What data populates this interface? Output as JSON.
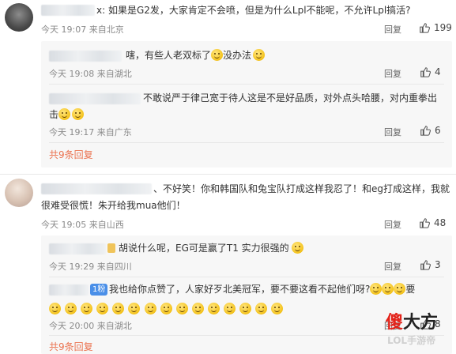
{
  "comments": [
    {
      "text_suffix": "x: 如果是G2发，大家肯定不会喷，但是为什么Lpl不能呢，不允许Lpl搞活?",
      "meta": "今天 19:07 来自北京",
      "reply": "回复",
      "likes": "199"
    },
    {
      "text_suffix": "、不好笑！你和韩国队和兔宝队打成这样我忍了！和eg打成这样，我就",
      "text_line2": "很难受很慌！朱开给我mua他们！",
      "meta": "今天 19:05 来自山西",
      "reply": "回复",
      "likes": "48"
    }
  ],
  "replies_a": [
    {
      "text_suffix": "嗐，有些人老双标了",
      "text_tail": "没办法",
      "meta": "今天 19:08 来自湖北",
      "reply": "回复",
      "likes": "4"
    },
    {
      "text_suffix": "不敢说严于律己宽于待人这是不是好品质，对外点头哈腰，对内重拳出",
      "text_line2": "击",
      "meta": "今天 19:17 来自广东",
      "reply": "回复",
      "likes": "6"
    }
  ],
  "more_a": "共9条回复",
  "replies_b": [
    {
      "text_suffix": "胡说什么呢，EG可是赢了T1 实力很强的",
      "meta": "今天 19:29 来自四川",
      "reply": "回复",
      "likes": "3"
    },
    {
      "badge": "1粉",
      "text_suffix": "我也给你点赞了，人家好歹北美冠军，要不要这看不起他们呀?",
      "text_tail": "要",
      "meta": "今天 20:00 来自湖北",
      "reply": "回复",
      "likes": "8"
    }
  ],
  "more_b": "共9条回复",
  "watermark": {
    "line1_a": "傻",
    "line1_b": "大方",
    "line2": "LOL手游帝"
  },
  "colors": {
    "link": "#eb7350",
    "meta": "#8a8a8a",
    "badge": "#4a8fe8",
    "watermark_red": "#e3231a"
  }
}
